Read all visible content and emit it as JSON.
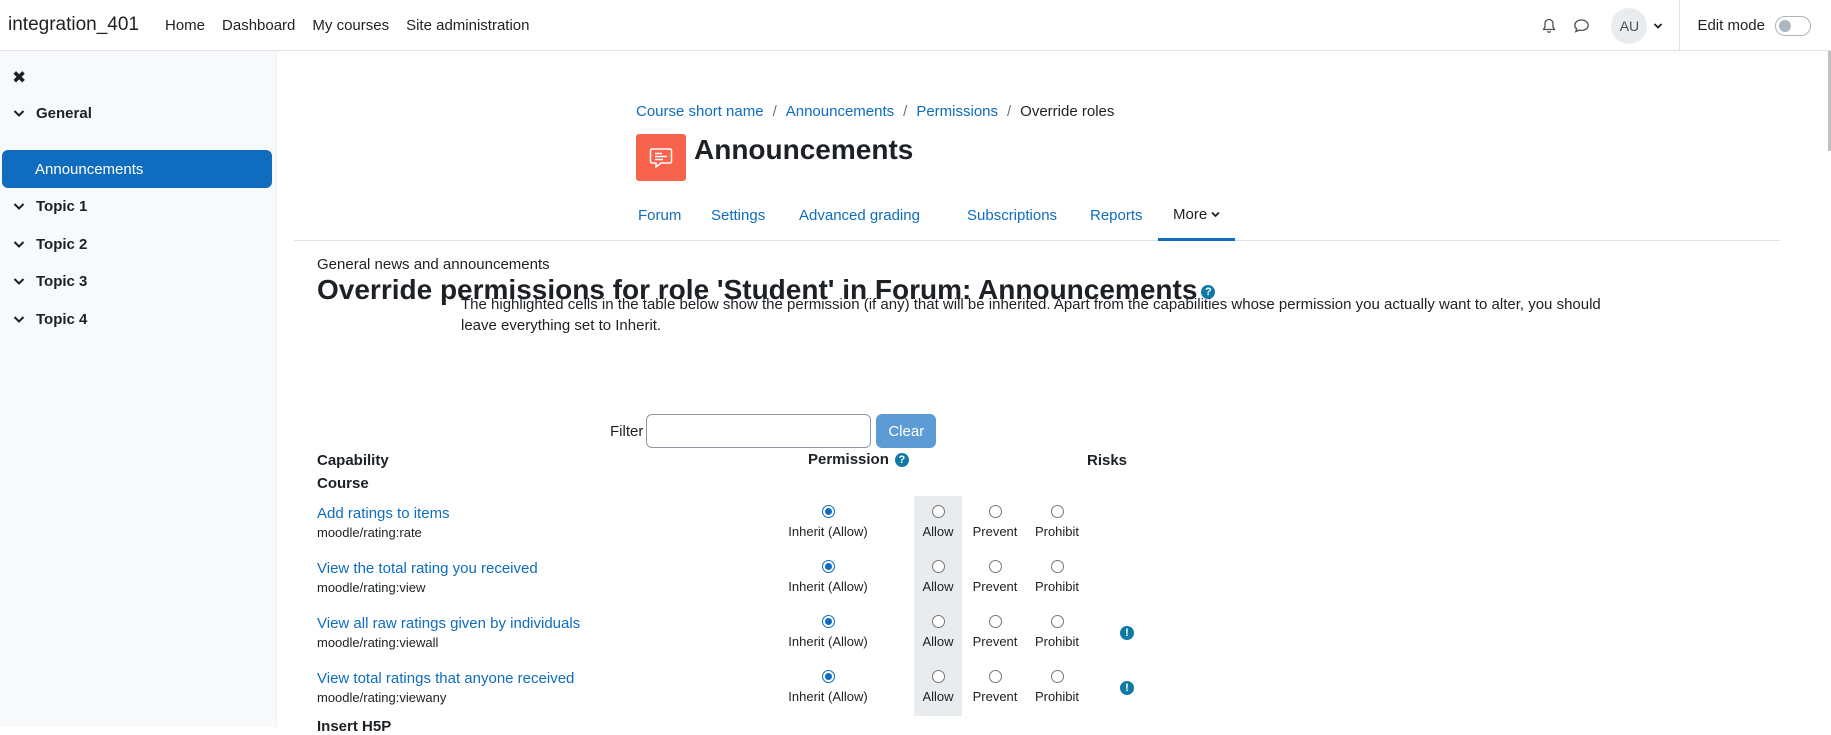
{
  "navbar": {
    "brand": "integration_401",
    "links": [
      "Home",
      "Dashboard",
      "My courses",
      "Site administration"
    ],
    "avatar_initials": "AU",
    "edit_mode_label": "Edit mode"
  },
  "drawer": {
    "sections": [
      {
        "label": "General",
        "expanded": true
      },
      {
        "label": "Announcements",
        "active": true
      },
      {
        "label": "Topic 1"
      },
      {
        "label": "Topic 2"
      },
      {
        "label": "Topic 3"
      },
      {
        "label": "Topic 4"
      }
    ]
  },
  "breadcrumb": [
    "Course short name",
    "Announcements",
    "Permissions",
    "Override roles"
  ],
  "page_title": "Announcements",
  "tabs": [
    "Forum",
    "Settings",
    "Advanced grading",
    "Subscriptions",
    "Reports",
    "More"
  ],
  "intro": "General news and announcements",
  "heading": "Override permissions for role 'Student' in Forum: Announcements",
  "notice": "The highlighted cells in the table below show the permission (if any) that will be inherited. Apart from the capabilities whose permission you actually want to alter, you should leave everything set to Inherit.",
  "filter": {
    "label": "Filter",
    "value": "",
    "clear_label": "Clear"
  },
  "table": {
    "col_capability": "Capability",
    "col_permission": "Permission",
    "col_risks": "Risks",
    "group_course": "Course",
    "group_next": "Insert H5P",
    "options": [
      "Inherit (Allow)",
      "Allow",
      "Prevent",
      "Prohibit"
    ],
    "rows": [
      {
        "name": "Add ratings to items",
        "id": "moodle/rating:rate",
        "selected": "Inherit (Allow)",
        "risk": false
      },
      {
        "name": "View the total rating you received",
        "id": "moodle/rating:view",
        "selected": "Inherit (Allow)",
        "risk": false
      },
      {
        "name": "View all raw ratings given by individuals",
        "id": "moodle/rating:viewall",
        "selected": "Inherit (Allow)",
        "risk": true
      },
      {
        "name": "View total ratings that anyone received",
        "id": "moodle/rating:viewany",
        "selected": "Inherit (Allow)",
        "risk": true
      }
    ]
  },
  "colors": {
    "primary": "#0f6cbf",
    "activity_icon": "#f7634d",
    "clear_button": "#5d9bd5",
    "help_icon": "#0f7aa3"
  }
}
